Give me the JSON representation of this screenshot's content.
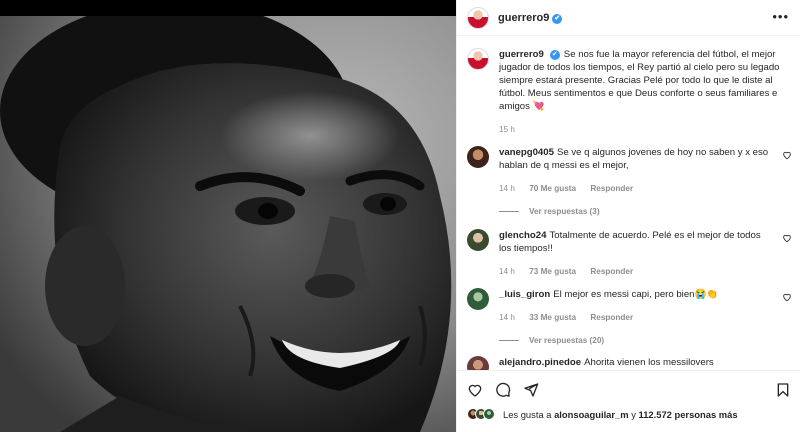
{
  "post": {
    "username": "guerrero9",
    "verified_mark": "✔"
  },
  "caption": {
    "username": "guerrero9",
    "text": "Se nos fue la mayor referencia del fútbol, el mejor jugador de todos los tiempos, el Rey partió al cielo pero su legado siempre estará presente. Gracias Pelé por todo lo que le diste al fútbol. Meus sentimentos e que Deus conforte o seus familiares e amigos 💘",
    "time": "15 h"
  },
  "comments": [
    {
      "username": "vanepg0405",
      "text": "Se ve q algunos jovenes de hoy no saben y x eso hablan de q messi es el mejor,",
      "time": "14 h",
      "likes": "70 Me gusta",
      "reply_label": "Responder",
      "replies_label": "Ver respuestas (3)"
    },
    {
      "username": "glencho24",
      "text": "Totalmente de acuerdo. Pelé es el mejor de todos los tiempos!!",
      "time": "14 h",
      "likes": "73 Me gusta",
      "reply_label": "Responder"
    },
    {
      "username": "_luis_giron",
      "text": "El mejor es messi capi, pero bien😭👏",
      "time": "14 h",
      "likes": "33 Me gusta",
      "reply_label": "Responder",
      "replies_label": "Ver respuestas (20)"
    },
    {
      "username": "alejandro.pinedoe",
      "text": "Ahorita vienen los messilovers"
    }
  ],
  "likes": {
    "prefix": "Les gusta a",
    "user": "alonsoaguilar_m",
    "connector": "y",
    "count": "112.572 personas más"
  },
  "icons": {
    "more": "more-options-icon",
    "like": "heart-icon",
    "comment": "comment-icon",
    "share": "send-icon",
    "save": "bookmark-icon"
  },
  "colors": {
    "verified": "#3897f0",
    "muted": "#8e8e8e",
    "text": "#262626"
  }
}
